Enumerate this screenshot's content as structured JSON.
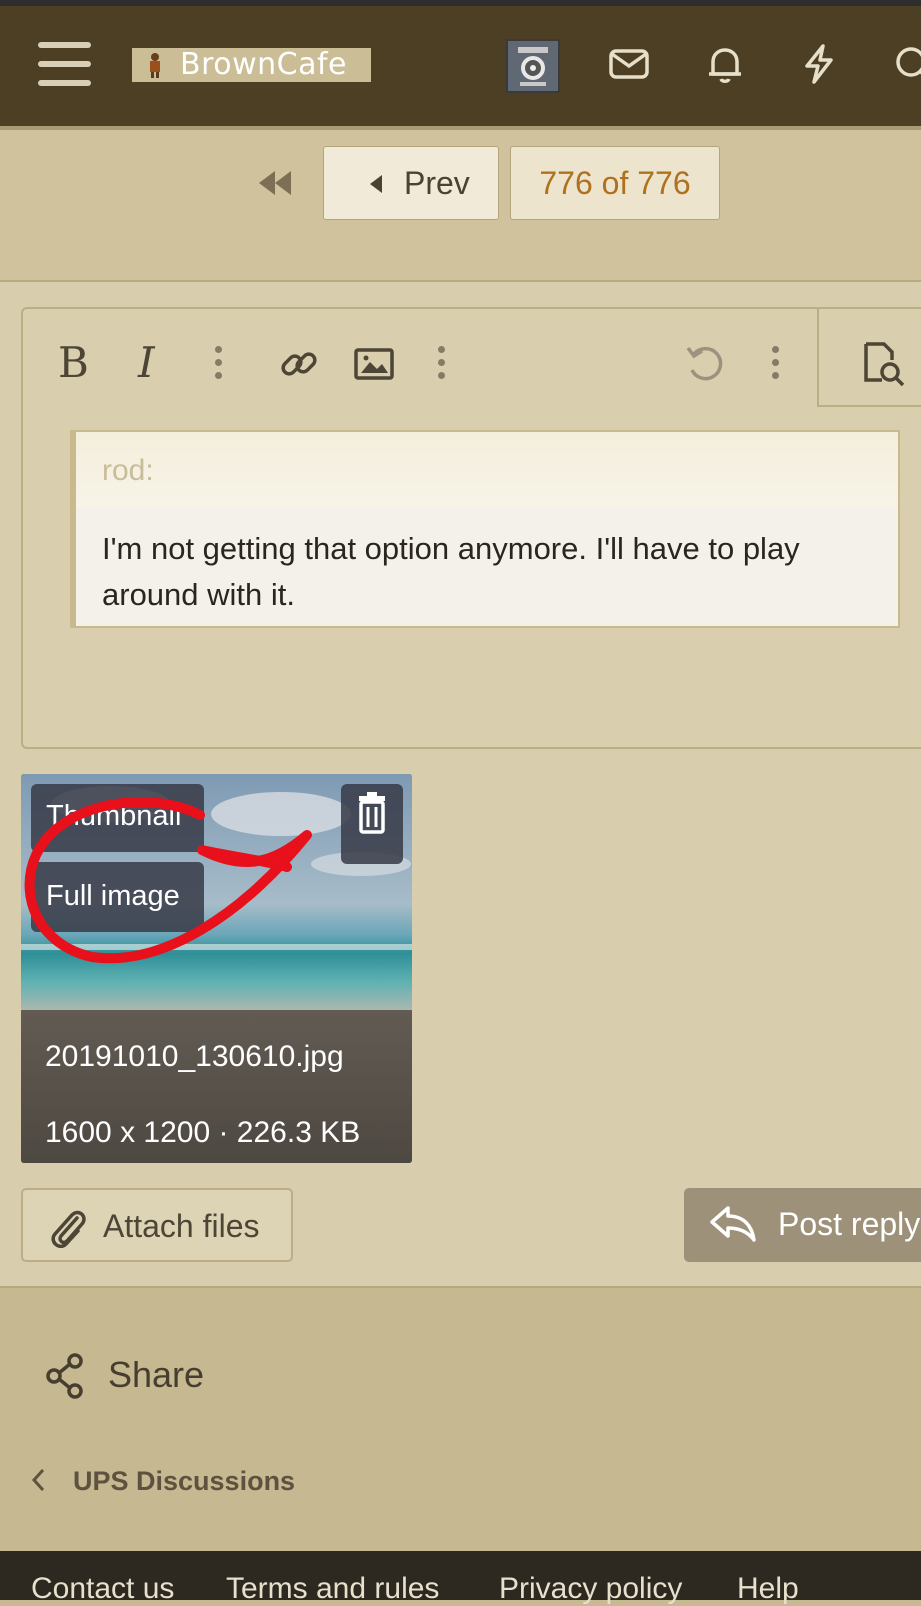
{
  "header": {
    "logo_text": "BrownCafe",
    "icons": [
      "menu-icon",
      "mail-icon",
      "bell-icon",
      "lightning-icon",
      "search-icon"
    ]
  },
  "pager": {
    "prev_label": "Prev",
    "page_label": "776 of 776"
  },
  "editor": {
    "toolbar": [
      "bold",
      "italic",
      "more",
      "link",
      "image",
      "more",
      "undo",
      "more",
      "preview"
    ],
    "bold_label": "B",
    "italic_label": "I",
    "quote": {
      "author": "rod:",
      "text": "I'm not getting that option anymore.  I'll have to play around with it."
    }
  },
  "attachment": {
    "thumbnail_label": "Thumbnail",
    "full_image_label": "Full image",
    "filename": "20191010_130610.jpg",
    "meta": "1600 x 1200 · 226.3 KB"
  },
  "actions": {
    "attach_label": "Attach files",
    "reply_label": "Post reply"
  },
  "share_label": "Share",
  "breadcrumb": "UPS Discussions",
  "footer_links": [
    "Contact us",
    "Terms and rules",
    "Privacy policy",
    "Help"
  ],
  "colors": {
    "header_bg": "#4c3f24",
    "page_bg": "#d8cdad",
    "accent": "#b0711f",
    "annotation": "#e8101a"
  }
}
